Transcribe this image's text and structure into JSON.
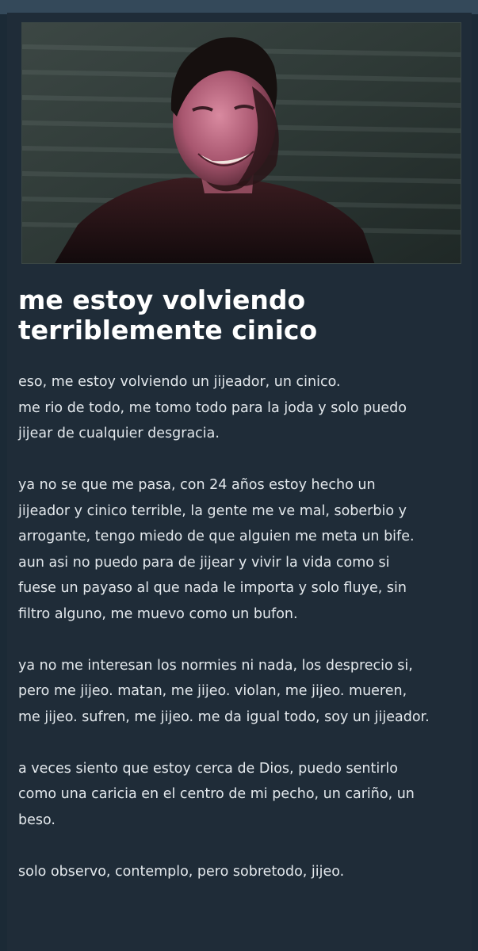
{
  "post": {
    "image_description": "dark-haired man grinning in shadowy room",
    "title": "me estoy volviendo terriblemente cinico",
    "paragraphs": [
      "eso, me estoy volviendo un jijeador, un cinico.\nme rio de todo, me tomo todo para la joda y solo puedo\njijear de cualquier desgracia.",
      "ya no se que me pasa, con 24 años estoy hecho un\njijeador y cinico terrible, la gente me ve mal, soberbio y\narrogante, tengo miedo de que alguien me meta un bife.\naun asi no puedo para de jijear y vivir la vida como si\nfuese un payaso al que nada le importa y solo fluye, sin\nfiltro alguno, me muevo como un bufon.",
      "ya no me interesan los normies ni nada, los desprecio si,\npero me jijeo. matan, me jijeo. violan, me jijeo. mueren,\nme jijeo. sufren, me jijeo. me da igual todo, soy un jijeador.",
      "a veces siento que estoy cerca de Dios, puedo sentirlo\ncomo una caricia en el centro de mi pecho, un cariño, un\nbeso.",
      "solo observo, contemplo, pero sobretodo, jijeo."
    ]
  },
  "colors": {
    "page_background": "#1b2a36",
    "card_background": "#1f2c38",
    "top_strip": "#34495a",
    "title_text": "#ffffff",
    "body_text": "#e3e8ec"
  }
}
